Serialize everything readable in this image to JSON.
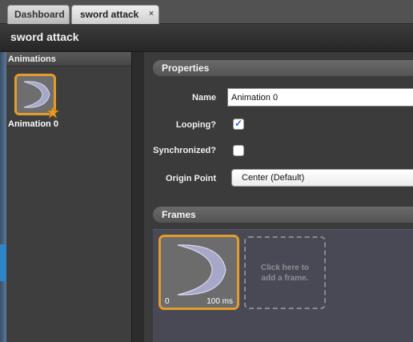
{
  "tabs": [
    {
      "label": "Dashboard",
      "closable": false
    },
    {
      "label": "sword attack",
      "closable": true,
      "close_glyph": "×"
    }
  ],
  "title": "sword attack",
  "animations": {
    "header": "Animations",
    "items": [
      {
        "label": "Animation 0",
        "icon": "crescent-slash-icon",
        "badge": "star-badge-icon"
      }
    ]
  },
  "properties": {
    "header": "Properties",
    "name_label": "Name",
    "name_value": "Animation 0",
    "looping_label": "Looping?",
    "looping_checked": true,
    "synchronized_label": "Synchronized?",
    "synchronized_checked": false,
    "origin_label": "Origin Point",
    "origin_value": "Center (Default)"
  },
  "frames": {
    "header": "Frames",
    "items": [
      {
        "index": "0",
        "duration": "100 ms",
        "icon": "crescent-slash-icon"
      }
    ],
    "add_text": "Click here to\nadd a frame."
  },
  "colors": {
    "selection_border": "#e39c2b",
    "checkmark": "#2a66d6",
    "frames_background": "#484955"
  }
}
